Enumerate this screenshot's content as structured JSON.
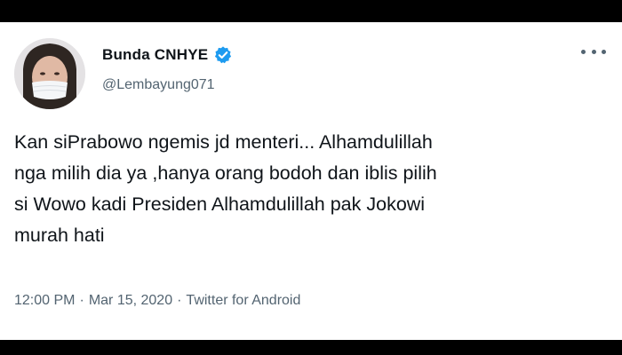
{
  "tweet": {
    "author": {
      "display_name": "Bunda CNHYE",
      "handle": "@Lembayung071",
      "verified": true,
      "avatar_icon": "profile-photo"
    },
    "text_lines": [
      "Kan siPrabowo ngemis jd menteri... Alhamdulillah",
      "nga milih dia ya ,hanya orang bodoh dan iblis pilih",
      "si Wowo kadi Presiden Alhamdulillah pak Jokowi",
      "murah hati"
    ],
    "time": "12:00 PM",
    "separator": "·",
    "date": "Mar 15, 2020",
    "source": "Twitter for Android"
  },
  "colors": {
    "verified": "#1d9bf0",
    "secondary_text": "#536471",
    "primary_text": "#0f1419"
  }
}
